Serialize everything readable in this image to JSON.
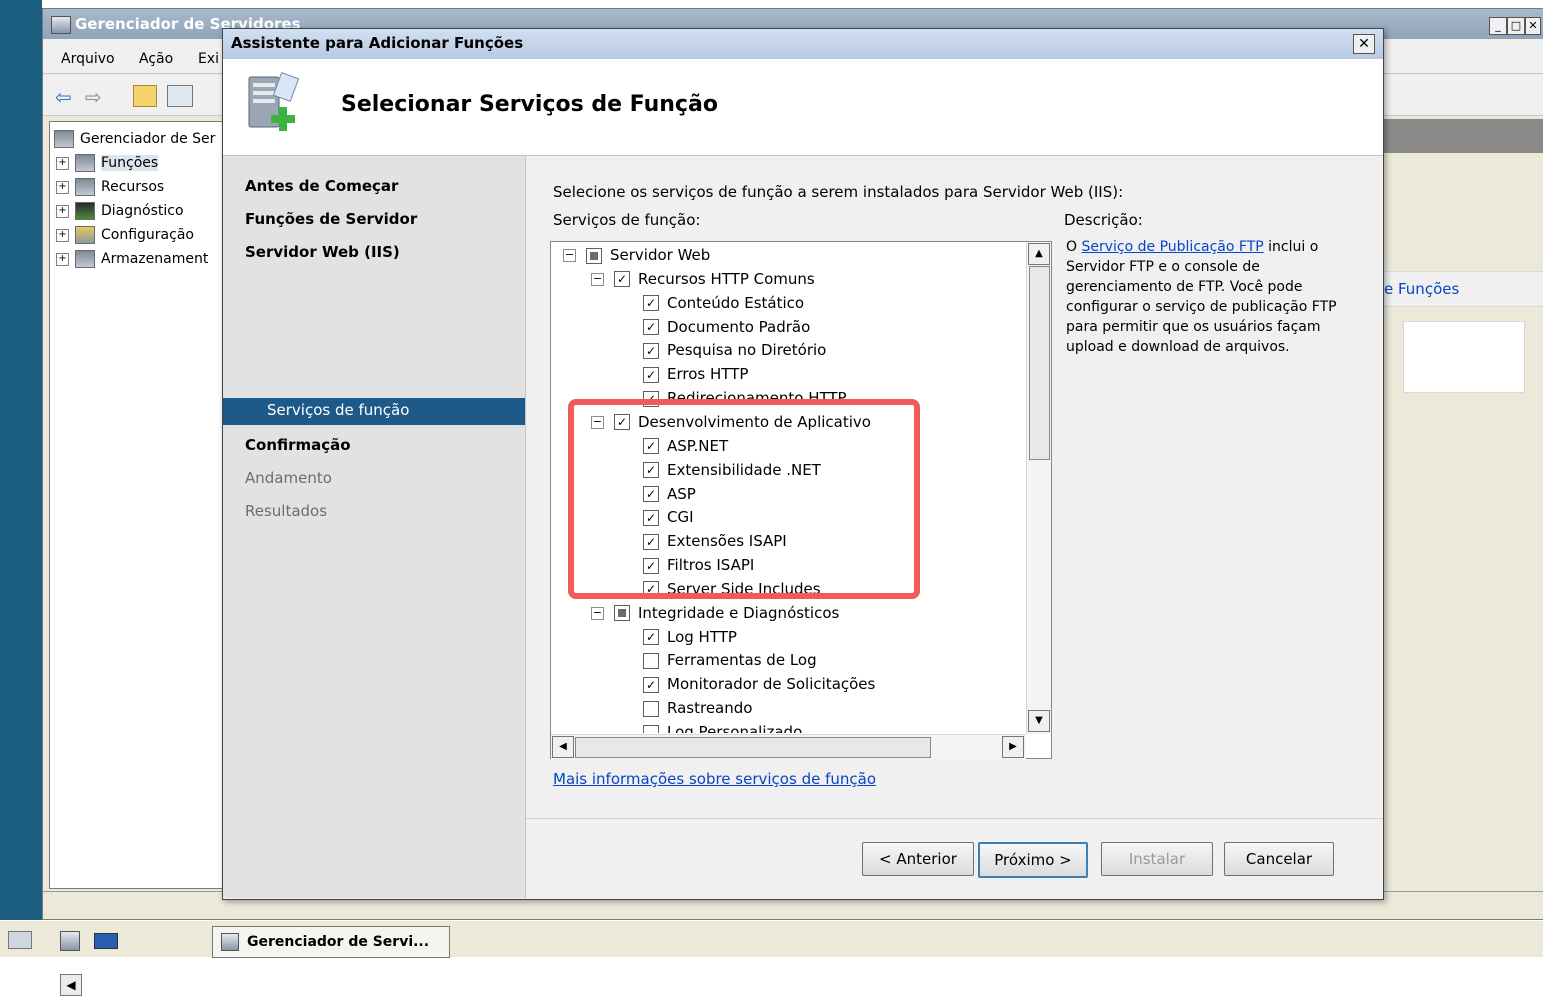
{
  "main_window": {
    "title": "Gerenciador de Servidores",
    "menu": [
      "Arquivo",
      "Ação",
      "Exi"
    ],
    "tree": [
      {
        "label": "Gerenciador de Ser"
      },
      {
        "label": "Funções"
      },
      {
        "label": "Recursos"
      },
      {
        "label": "Diagnóstico"
      },
      {
        "label": "Configuração"
      },
      {
        "label": "Armazenament"
      }
    ],
    "right_link": "e Funções"
  },
  "dialog": {
    "title": "Assistente para Adicionar Funções",
    "close_label": "✕",
    "header_title": "Selecionar Serviços de Função",
    "nav": [
      {
        "label": "Antes de Começar"
      },
      {
        "label": "Funções de Servidor"
      },
      {
        "label": "Servidor Web (IIS)"
      },
      {
        "label": "Serviços de função"
      },
      {
        "label": "Confirmação"
      },
      {
        "label": "Andamento"
      },
      {
        "label": "Resultados"
      }
    ],
    "instruction": "Selecione os serviços de função a serem instalados para Servidor Web (IIS):",
    "services_label": "Serviços de função:",
    "description_label": "Descrição:",
    "description": {
      "prefix": "O ",
      "link": "Serviço de Publicação FTP",
      "text": " inclui o Servidor FTP e o console de gerenciamento de FTP. Você pode configurar o serviço de publicação FTP para permitir que os usuários façam upload e download de arquivos."
    },
    "tree": [
      {
        "label": "Servidor Web",
        "state": "partial",
        "expander": "⊟"
      },
      {
        "label": "Recursos HTTP Comuns",
        "state": "checked",
        "expander": "⊟"
      },
      {
        "label": "Conteúdo Estático",
        "state": "checked"
      },
      {
        "label": "Documento Padrão",
        "state": "checked"
      },
      {
        "label": "Pesquisa no Diretório",
        "state": "checked"
      },
      {
        "label": "Erros HTTP",
        "state": "checked"
      },
      {
        "label": "Redirecionamento HTTP",
        "state": "checked"
      },
      {
        "label": "Desenvolvimento de Aplicativo",
        "state": "checked",
        "expander": "⊟"
      },
      {
        "label": "ASP.NET",
        "state": "checked"
      },
      {
        "label": "Extensibilidade .NET",
        "state": "checked"
      },
      {
        "label": "ASP",
        "state": "checked"
      },
      {
        "label": "CGI",
        "state": "checked"
      },
      {
        "label": "Extensões ISAPI",
        "state": "checked"
      },
      {
        "label": "Filtros ISAPI",
        "state": "checked"
      },
      {
        "label": "Server Side Includes",
        "state": "checked"
      },
      {
        "label": "Integridade e Diagnósticos",
        "state": "partial",
        "expander": "⊟"
      },
      {
        "label": "Log HTTP",
        "state": "checked"
      },
      {
        "label": "Ferramentas de Log",
        "state": "unchecked"
      },
      {
        "label": "Monitorador de Solicitações",
        "state": "checked"
      },
      {
        "label": "Rastreando",
        "state": "unchecked"
      },
      {
        "label": "Log Personalizado",
        "state": "unchecked"
      }
    ],
    "more_info_link": "Mais informações sobre serviços de função",
    "buttons": {
      "back": "< Anterior",
      "next": "Próximo >",
      "install": "Instalar",
      "cancel": "Cancelar"
    }
  },
  "taskbar": {
    "task_label": "Gerenciador de Servi..."
  },
  "colors": {
    "highlight": "#f05a5a",
    "nav_selected": "#1d5a8a",
    "link": "#0645c8"
  }
}
